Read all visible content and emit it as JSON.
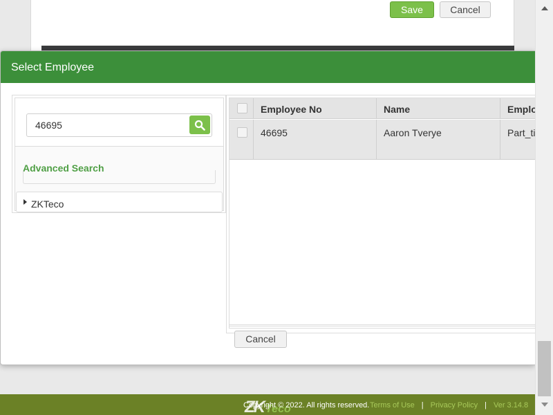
{
  "background": {
    "save_label": "Save",
    "cancel_label": "Cancel"
  },
  "modal": {
    "title": "Select Employee",
    "search": {
      "value": "46695"
    },
    "advanced_search_label": "Advanced Search",
    "tree": {
      "root_label": "ZKTeco"
    },
    "grid": {
      "columns": [
        "Employee No",
        "Name",
        "Employee Type"
      ],
      "rows": [
        {
          "employee_no": "46695",
          "name": "Aaron Tverye",
          "type": "Part_time"
        }
      ]
    },
    "cancel_label": "Cancel"
  },
  "footer": {
    "logo": "ZK",
    "logo_suffix": "Teco",
    "copyright": "Copyright © 2022. All rights reserved.",
    "links": [
      "Terms of Use",
      "Privacy Policy"
    ],
    "version": "Ver 3.14.8"
  },
  "colors": {
    "header_green": "#3c8f3a",
    "button_green": "#7cc04a",
    "footer_olive": "#6b8126",
    "link_green": "#4f9f45"
  },
  "icons": [
    "search-icon",
    "tree-expand-icon",
    "scroll-up-icon",
    "scroll-down-icon"
  ]
}
